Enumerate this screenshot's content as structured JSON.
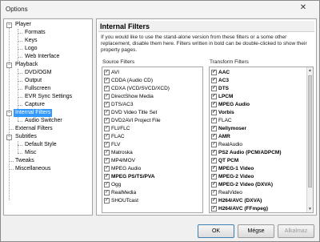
{
  "window": {
    "title": "Options",
    "close_glyph": "✕"
  },
  "tree": {
    "items": [
      {
        "label": "Player",
        "toggle": "−"
      },
      {
        "label": "Formats"
      },
      {
        "label": "Keys"
      },
      {
        "label": "Logo"
      },
      {
        "label": "Web Interface"
      },
      {
        "label": "Playback",
        "toggle": "−"
      },
      {
        "label": "DVD/OGM"
      },
      {
        "label": "Output"
      },
      {
        "label": "Fullscreen"
      },
      {
        "label": "EVR Sync Settings"
      },
      {
        "label": "Capture"
      },
      {
        "label": "Internal Filters",
        "toggle": "−",
        "selected": true
      },
      {
        "label": "Audio Switcher"
      },
      {
        "label": "External Filters"
      },
      {
        "label": "Subtitles",
        "toggle": "−"
      },
      {
        "label": "Default Style"
      },
      {
        "label": "Misc"
      },
      {
        "label": "Tweaks"
      },
      {
        "label": "Miscellaneous"
      }
    ]
  },
  "panel": {
    "title": "Internal Filters",
    "description": "If you would like to use the stand-alone version from these filters or a some other replacement, disable them here. Filters written in bold can be double-clicked to show their property pages.",
    "source_label": "Source Filters",
    "transform_label": "Transform Filters",
    "check_glyph": "✓",
    "source_filters": [
      {
        "label": "AVI",
        "bold": false
      },
      {
        "label": "CDDA (Audio CD)",
        "bold": false
      },
      {
        "label": "CDXA (VCD/SVCD/XCD)",
        "bold": false
      },
      {
        "label": "DirectShow Media",
        "bold": false
      },
      {
        "label": "DTS/AC3",
        "bold": false
      },
      {
        "label": "DVD Video Title Set",
        "bold": false
      },
      {
        "label": "DVD2AVI Project File",
        "bold": false
      },
      {
        "label": "FLI/FLC",
        "bold": false
      },
      {
        "label": "FLAC",
        "bold": false
      },
      {
        "label": "FLV",
        "bold": false
      },
      {
        "label": "Matroska",
        "bold": false
      },
      {
        "label": "MP4/MOV",
        "bold": false
      },
      {
        "label": "MPEG Audio",
        "bold": false
      },
      {
        "label": "MPEG PS/TS/PVA",
        "bold": true
      },
      {
        "label": "Ogg",
        "bold": false
      },
      {
        "label": "RealMedia",
        "bold": false
      },
      {
        "label": "SHOUTcast",
        "bold": false
      }
    ],
    "transform_filters": [
      {
        "label": "AAC",
        "bold": true
      },
      {
        "label": "AC3",
        "bold": true
      },
      {
        "label": "DTS",
        "bold": true
      },
      {
        "label": "LPCM",
        "bold": true
      },
      {
        "label": "MPEG Audio",
        "bold": true
      },
      {
        "label": "Vorbis",
        "bold": true
      },
      {
        "label": "FLAC",
        "bold": false
      },
      {
        "label": "Nellymoser",
        "bold": true
      },
      {
        "label": "AMR",
        "bold": true
      },
      {
        "label": "RealAudio",
        "bold": false
      },
      {
        "label": "PS2 Audio (PCM/ADPCM)",
        "bold": true
      },
      {
        "label": "QT PCM",
        "bold": true
      },
      {
        "label": "MPEG-1 Video",
        "bold": true
      },
      {
        "label": "MPEG-2 Video",
        "bold": true
      },
      {
        "label": "MPEG-2 Video (DXVA)",
        "bold": true
      },
      {
        "label": "RealVideo",
        "bold": false
      },
      {
        "label": "H264/AVC (DXVA)",
        "bold": true
      },
      {
        "label": "H264/AVC (FFmpeg)",
        "bold": true
      }
    ]
  },
  "buttons": {
    "ok": "OK",
    "cancel": "Mégse",
    "apply": "Alkalmaz"
  }
}
